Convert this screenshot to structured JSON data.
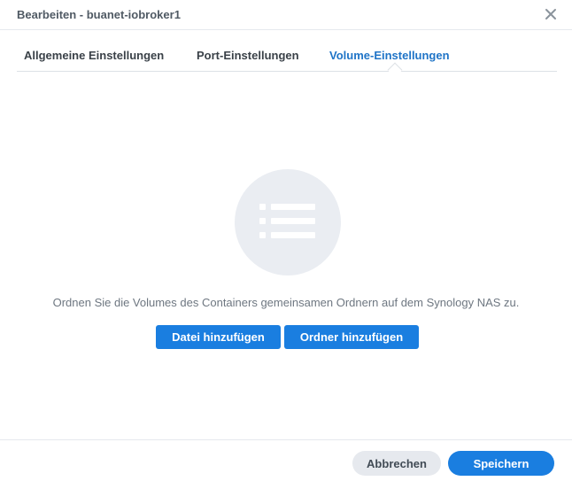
{
  "dialog": {
    "title": "Bearbeiten - buanet-iobroker1",
    "close_icon": "close-icon"
  },
  "tabs": [
    {
      "label": "Allgemeine Einstellungen",
      "active": false
    },
    {
      "label": "Port-Einstellungen",
      "active": false
    },
    {
      "label": "Volume-Einstellungen",
      "active": true
    }
  ],
  "empty_state": {
    "icon": "list-icon",
    "message": "Ordnen Sie die Volumes des Containers gemeinsamen Ordnern auf dem Synology NAS zu.",
    "add_file_label": "Datei hinzufügen",
    "add_folder_label": "Ordner hinzufügen"
  },
  "footer": {
    "cancel_label": "Abbrechen",
    "save_label": "Speichern"
  },
  "colors": {
    "accent": "#1a7ee0",
    "active_tab": "#1f74c7",
    "empty_icon_bg": "#eaedf2"
  }
}
